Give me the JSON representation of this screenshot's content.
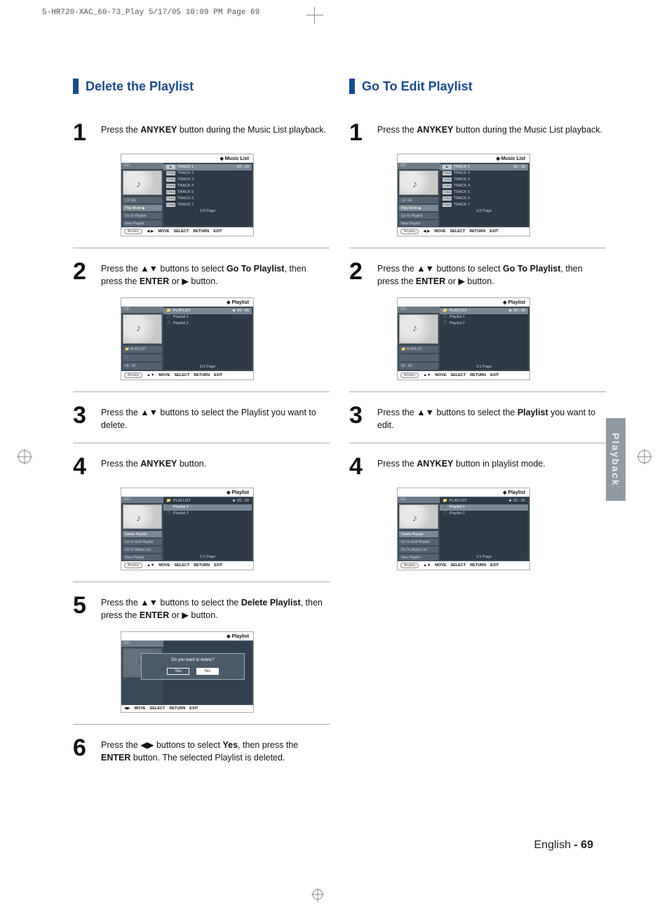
{
  "print_header": "5-HR720-XAC_60-73_Play  5/17/05  10:09 PM  Page 69",
  "side_tab": "Playback",
  "page_footer_lang": "English",
  "page_footer_dash": " - ",
  "page_footer_num": "69",
  "left": {
    "heading": "Delete the Playlist",
    "steps": {
      "s1": {
        "num": "1",
        "pre": "Press the ",
        "bold": "ANYKEY",
        "post": " button during the Music List playback."
      },
      "s2": {
        "num": "2",
        "text": "Press the ▲▼ buttons to select ",
        "bold": "Go To Playlist",
        "post2": ", then press the ",
        "bold2": "ENTER",
        "post3": " or ▶ button."
      },
      "s3": {
        "num": "3",
        "text": "Press the ▲▼ buttons to select the Playlist you want to delete."
      },
      "s4": {
        "num": "4",
        "pre": "Press the ",
        "bold": "ANYKEY",
        "post": " button."
      },
      "s5": {
        "num": "5",
        "text": "Press the ▲▼ buttons to select the ",
        "bold": "Delete Playlist",
        "post2": ", then press the   ",
        "bold2": "ENTER",
        "post3": " or ▶ button."
      },
      "s6": {
        "num": "6",
        "text": "Press the ◀▶ buttons to select ",
        "bold": "Yes",
        "post2": ", then press the ",
        "bold2": "ENTER",
        "post3": " button. The selected Playlist is deleted."
      }
    }
  },
  "right": {
    "heading": "Go To Edit Playlist",
    "steps": {
      "s1": {
        "num": "1",
        "pre": "Press the ",
        "bold": "ANYKEY",
        "post": " button during the Music List playback."
      },
      "s2": {
        "num": "2",
        "text": "Press the ▲▼ buttons to select ",
        "bold": "Go To Playlist",
        "post2": ", then press the ",
        "bold2": "ENTER",
        "post3": " or ▶ button."
      },
      "s3": {
        "num": "3",
        "text": "Press the ▲▼ buttons to select the ",
        "bold": "Playlist",
        "post2": " you want to edit."
      },
      "s4": {
        "num": "4",
        "pre": "Press the ",
        "bold": "ANYKEY",
        "post": " button in playlist mode."
      }
    }
  },
  "shot_common": {
    "footer_anykey": "Anykey",
    "footer_move": "MOVE",
    "footer_select": "SELECT",
    "footer_return": "RETURN",
    "footer_exit": "EXIT"
  },
  "shot_musiclist": {
    "title": "Music List",
    "sidebar_label_cd": "CD",
    "sidebar_label_disc": "CD DA",
    "side_playmode": "Play Mode      ▶",
    "side_goto": "Go To Playlist",
    "side_new": "New Playlist",
    "tracks": [
      "TRACK 1",
      "TRACK 2",
      "TRACK 3",
      "TRACK 4",
      "TRACK 5",
      "TRACK 6",
      "TRACK 7"
    ],
    "time": "02 : 10",
    "pager": "1/3 Page",
    "badge": "CDDA",
    "move_icon": "◀ ▶"
  },
  "shot_playlist": {
    "title": "Playlist",
    "sidebar_label_cd": "CD",
    "folder": "PLAYLIST",
    "dashes": "- -",
    "time": "00 : 00",
    "header": "PLAYLIST",
    "items": [
      "Playlist 1",
      "Playlist 2"
    ],
    "pager": "1/1 Page",
    "move_icon": "▲▼"
  },
  "shot_anykey_menu": {
    "items": [
      "Delete Playlist",
      "Go To Edit Playlist",
      "Go To Music List",
      "New Playlist"
    ]
  },
  "shot_confirm": {
    "question": "Do you want to delete?",
    "yes": "Yes",
    "no": "No",
    "move_icon": "◀▶"
  }
}
